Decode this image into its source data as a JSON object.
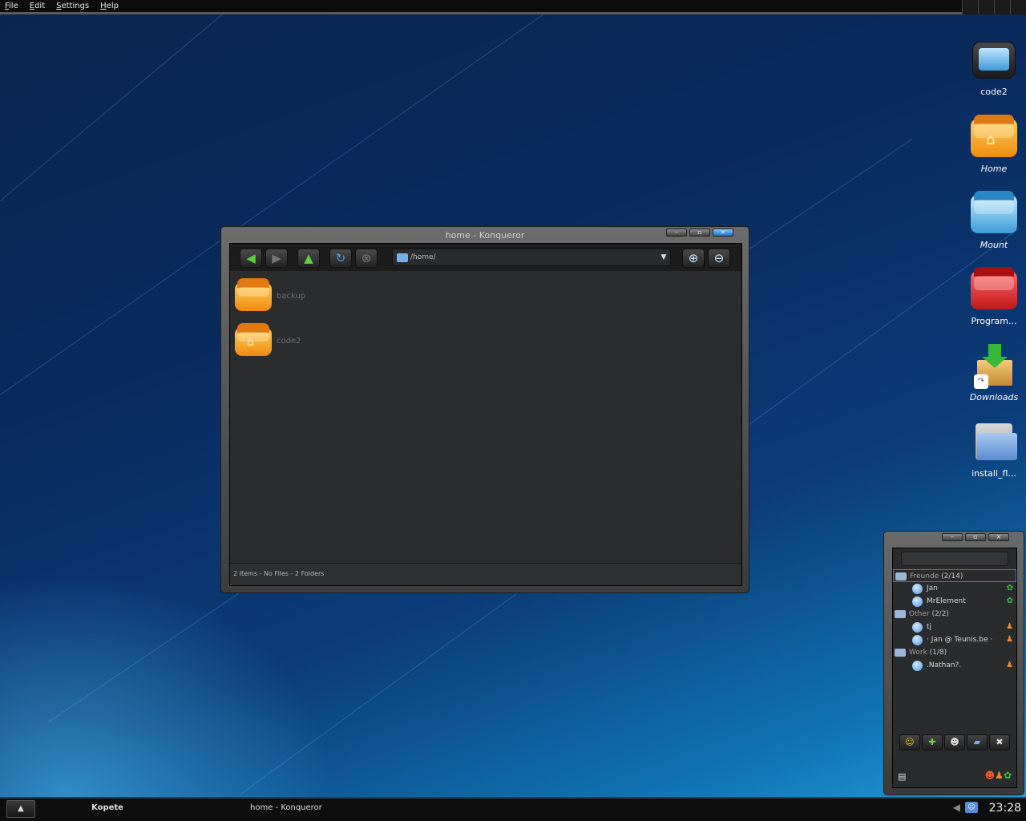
{
  "menubar": {
    "items": [
      "File",
      "Edit",
      "Settings",
      "Help"
    ]
  },
  "desktop": {
    "icons": [
      {
        "label": "code2",
        "italic": false
      },
      {
        "label": "Home",
        "italic": true
      },
      {
        "label": "Mount",
        "italic": true
      },
      {
        "label": "Program...",
        "italic": false
      },
      {
        "label": "Downloads",
        "italic": true
      },
      {
        "label": "install_fl...",
        "italic": false
      }
    ]
  },
  "konqueror": {
    "title": "home - Konqueror",
    "window_buttons": [
      "–",
      "▫",
      "×"
    ],
    "location": "/home/",
    "files": [
      {
        "name": "backup"
      },
      {
        "name": "code2"
      }
    ],
    "status": "2 Items - No Files - 2 Folders"
  },
  "kopete": {
    "window_buttons": [
      "–",
      "▫",
      "×"
    ],
    "groups": [
      {
        "name": "Freunde",
        "count": "(2/14)",
        "contacts": [
          {
            "name": "Jan",
            "status_icon": "icq-online-icon"
          },
          {
            "name": "MrElement",
            "status_icon": "icq-online-icon"
          }
        ]
      },
      {
        "name": "Other",
        "count": "(2/2)",
        "contacts": [
          {
            "name": "tj",
            "status_icon": "msn-online-icon"
          },
          {
            "name": "· Jan @ Teunis.be ·",
            "status_icon": "msn-online-icon"
          }
        ]
      },
      {
        "name": "Work",
        "count": "(1/8)",
        "contacts": [
          {
            "name": ".Nathan?.",
            "status_icon": "msn-online-icon"
          }
        ]
      }
    ]
  },
  "taskbar": {
    "tasks": [
      "Kopete",
      "home - Konqueror"
    ],
    "clock": "23:28"
  }
}
